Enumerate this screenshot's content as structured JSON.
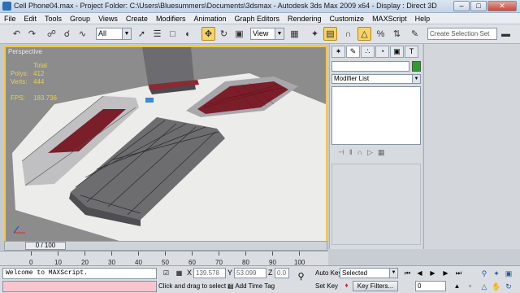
{
  "window": {
    "title": "Cell Phone04.max   - Project Folder: C:\\Users\\Bluesummers\\Documents\\3dsmax    - Autodesk 3ds Max  2009 x64    - Display : Direct 3D",
    "minimize": "–",
    "maximize": "□",
    "close": "✕"
  },
  "menu": [
    "File",
    "Edit",
    "Tools",
    "Group",
    "Views",
    "Create",
    "Modifiers",
    "Animation",
    "Graph Editors",
    "Rendering",
    "Customize",
    "MAXScript",
    "Help"
  ],
  "toolbar": {
    "selection_filter": "All",
    "reference_coord": "View",
    "selection_set_placeholder": "Create Selection Set"
  },
  "viewport": {
    "label": "Perspective",
    "stats": {
      "header": "Total",
      "polys_label": "Polys:",
      "polys_value": "412",
      "verts_label": "Verts:",
      "verts_value": "444",
      "fps_label": "FPS:",
      "fps_value": "183.736"
    }
  },
  "command_panel": {
    "modifier_list": "Modifier List",
    "tabs": [
      "✶",
      "✎",
      "∴",
      "◔",
      "▣",
      "T"
    ]
  },
  "timeline": {
    "frame_label": "0 / 100",
    "ticks": [
      "0",
      "10",
      "20",
      "30",
      "40",
      "50",
      "60",
      "70",
      "80",
      "90",
      "100"
    ]
  },
  "status": {
    "maxscript": "Welcome to MAXScript.",
    "prompt": "Click and drag to select an",
    "x_label": "X",
    "x_value": "139.578",
    "y_label": "Y",
    "y_value": "53.099",
    "z_label": "Z",
    "z_value": "0.0",
    "auto_key": "Auto Key",
    "selected": "Selected",
    "set_key": "Set Key",
    "key_filters": "Key Filters...",
    "add_time_tag": "Add Time Tag",
    "frame": "0"
  },
  "colors": {
    "viewport_border": "#f3c84a",
    "stats_text": "#e6d24a",
    "active_tool": "#f7d36a",
    "object_color": "#2aa02a"
  }
}
